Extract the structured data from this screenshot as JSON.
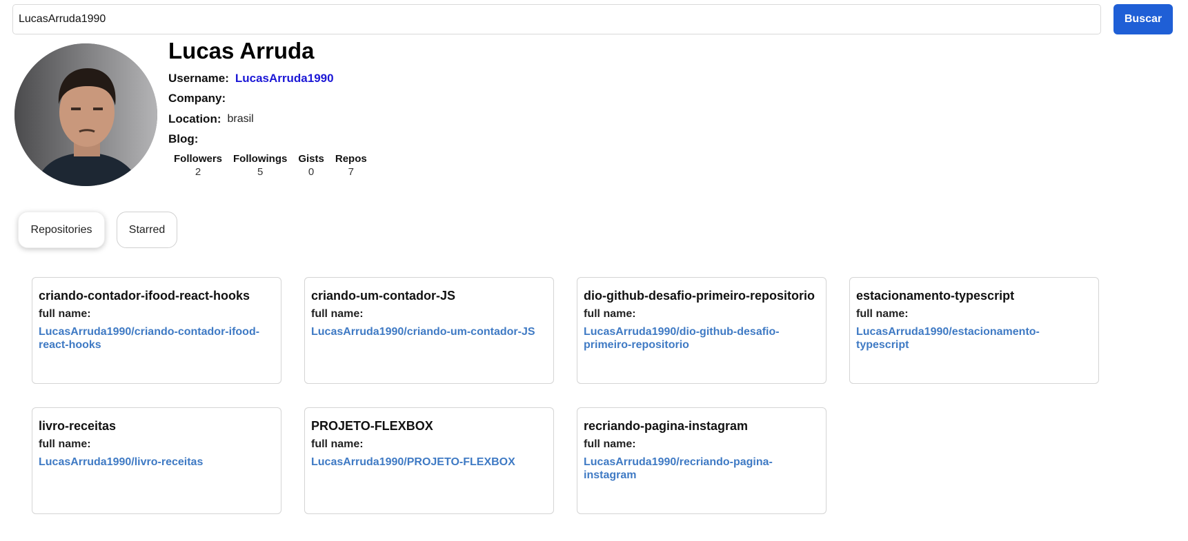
{
  "search": {
    "value": "LucasArruda1990",
    "button_label": "Buscar"
  },
  "profile": {
    "name": "Lucas Arruda",
    "username_label": "Username:",
    "username": "LucasArruda1990",
    "company_label": "Company:",
    "company": "",
    "location_label": "Location:",
    "location": "brasil",
    "blog_label": "Blog:",
    "blog": "",
    "stats": [
      {
        "label": "Followers",
        "value": "2"
      },
      {
        "label": "Followings",
        "value": "5"
      },
      {
        "label": "Gists",
        "value": "0"
      },
      {
        "label": "Repos",
        "value": "7"
      }
    ]
  },
  "tabs": [
    {
      "label": "Repositories",
      "active": true
    },
    {
      "label": "Starred",
      "active": false
    }
  ],
  "repos": [
    {
      "name": "criando-contador-ifood-react-hooks",
      "full_name_label": "full name:",
      "full_name": "LucasArruda1990/criando-contador-ifood-react-hooks"
    },
    {
      "name": "criando-um-contador-JS",
      "full_name_label": "full name:",
      "full_name": "LucasArruda1990/criando-um-contador-JS"
    },
    {
      "name": "dio-github-desafio-primeiro-repositorio",
      "full_name_label": "full name:",
      "full_name": "LucasArruda1990/dio-github-desafio-primeiro-repositorio"
    },
    {
      "name": "estacionamento-typescript",
      "full_name_label": "full name:",
      "full_name": "LucasArruda1990/estacionamento-typescript"
    },
    {
      "name": "livro-receitas",
      "full_name_label": "full name:",
      "full_name": "LucasArruda1990/livro-receitas"
    },
    {
      "name": "PROJETO-FLEXBOX",
      "full_name_label": "full name:",
      "full_name": "LucasArruda1990/PROJETO-FLEXBOX"
    },
    {
      "name": "recriando-pagina-instagram",
      "full_name_label": "full name:",
      "full_name": "LucasArruda1990/recriando-pagina-instagram"
    }
  ],
  "colors": {
    "accent": "#1f5fd6",
    "username": "#1b17d6",
    "repo_link": "#3f7ac4"
  }
}
